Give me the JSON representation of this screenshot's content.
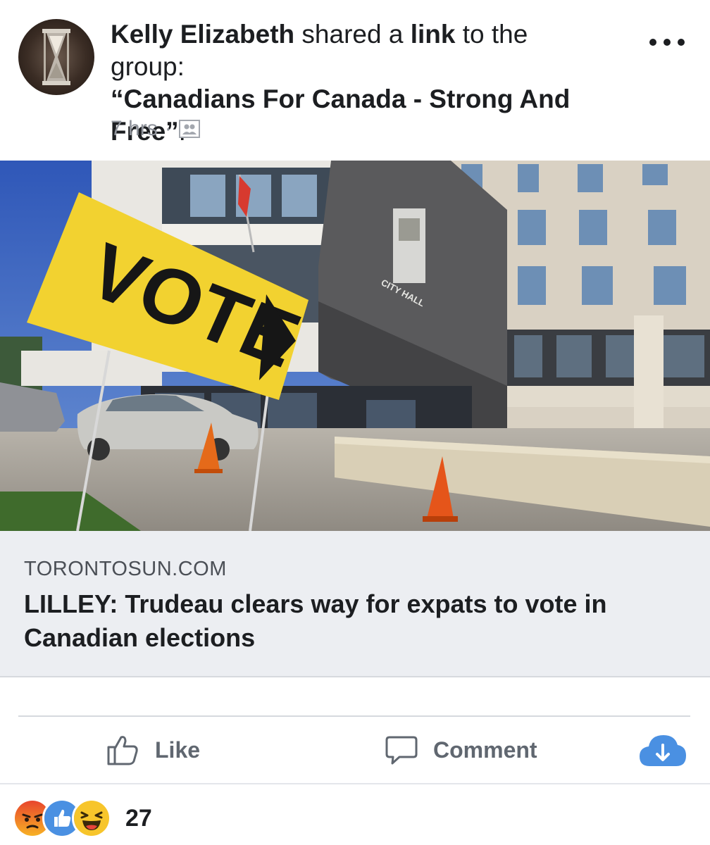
{
  "post": {
    "author": "Kelly Elizabeth",
    "shared_text": " shared a ",
    "link_word": "link",
    "to_group_text": " to the group: ",
    "group_name": "“Canadians For Canada - Strong And Free”",
    "period": ".",
    "time": "7 hrs",
    "separator": "·",
    "audience_icon": "group-icon",
    "more_icon": "more-icon"
  },
  "link": {
    "image_sign_text": "VOTE",
    "image_building_text": "CITY HALL",
    "domain": "TORONTOSUN.COM",
    "title": "LILLEY: Trudeau clears way for expats to vote in Canadian elections"
  },
  "actions": {
    "like_label": "Like",
    "like_icon": "thumbs-up-icon",
    "comment_label": "Comment",
    "comment_icon": "comment-bubble-icon",
    "download_icon": "cloud-download-icon"
  },
  "reactions": {
    "types": [
      "angry",
      "like",
      "haha"
    ],
    "count": "27"
  },
  "colors": {
    "accent": "#4a90e2",
    "muted_text": "#90949c",
    "caption_bg": "#eceef2",
    "sign_yellow": "#f2d230"
  }
}
